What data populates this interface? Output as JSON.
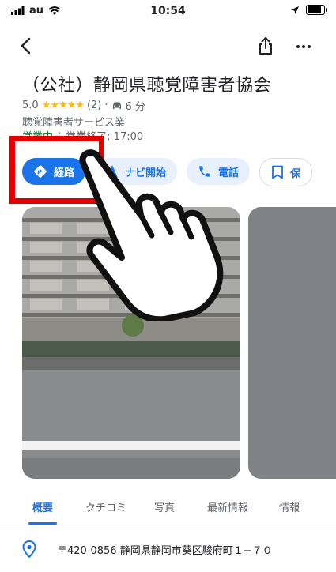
{
  "status_bar": {
    "carrier": "au",
    "time": "10:54"
  },
  "place": {
    "name": "（公社）静岡県聴覚障害者協会",
    "rating": "5.0",
    "stars": "★★★★★",
    "review_count": "(2)",
    "separator": "·",
    "drive_time": "6 分",
    "category": "聴覚障害者サービス業",
    "open_status": "営業中",
    "hours_separator": "·",
    "closing": "営業終了: 17:00"
  },
  "actions": [
    {
      "label": "経路",
      "icon": "directions-icon"
    },
    {
      "label": "ナビ開始",
      "icon": "navigation-arrow-icon"
    },
    {
      "label": "電話",
      "icon": "phone-icon"
    },
    {
      "label": "保",
      "icon": "bookmark-icon"
    }
  ],
  "tabs": [
    {
      "label": "概要",
      "active": true
    },
    {
      "label": "クチコミ",
      "active": false
    },
    {
      "label": "写真",
      "active": false
    },
    {
      "label": "最新情報",
      "active": false
    },
    {
      "label": "情報",
      "active": false
    }
  ],
  "address": {
    "icon": "location-pin-icon",
    "text": "〒420-0856 静岡県静岡市葵区駿府町１−７０"
  },
  "colors": {
    "accent": "#1a73e8",
    "highlight": "#e00000",
    "open": "#188038",
    "star": "#fbbc04"
  }
}
